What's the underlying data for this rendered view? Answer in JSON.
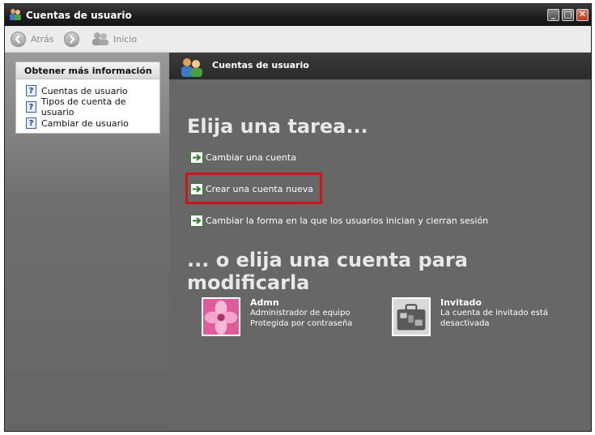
{
  "window": {
    "title": "Cuentas de usuario",
    "controls": {
      "minimize": "_",
      "maximize": "□",
      "close": "✕"
    }
  },
  "toolbar": {
    "back_label": "Atrás",
    "home_label": "Inicio"
  },
  "sidebar": {
    "title": "Obtener más información",
    "items": [
      {
        "label": "Cuentas de usuario",
        "icon": "help-icon"
      },
      {
        "label": "Tipos de cuenta de usuario",
        "icon": "help-icon"
      },
      {
        "label": "Cambiar de usuario",
        "icon": "help-icon"
      }
    ]
  },
  "main": {
    "header_title": "Cuentas de usuario",
    "task_heading": "Elija una tarea...",
    "tasks": [
      {
        "label": "Cambiar una cuenta"
      },
      {
        "label": "Crear una cuenta nueva",
        "highlighted": true
      },
      {
        "label": "Cambiar la forma en la que los usuarios inician y cierran sesión"
      }
    ],
    "account_heading": "... o elija una cuenta para modificarla",
    "accounts": [
      {
        "name": "Admn",
        "lines": [
          "Administrador de equipo",
          "Protegida por contraseña"
        ],
        "picture": "flower-picture"
      },
      {
        "name": "Invitado",
        "lines": [
          "La cuenta de invitado está",
          "desactivada"
        ],
        "picture": "suitcase-picture"
      }
    ]
  },
  "colors": {
    "accent_highlight": "#d3131a",
    "task_arrow": "#2e7d32",
    "panel_background": "#676767"
  }
}
